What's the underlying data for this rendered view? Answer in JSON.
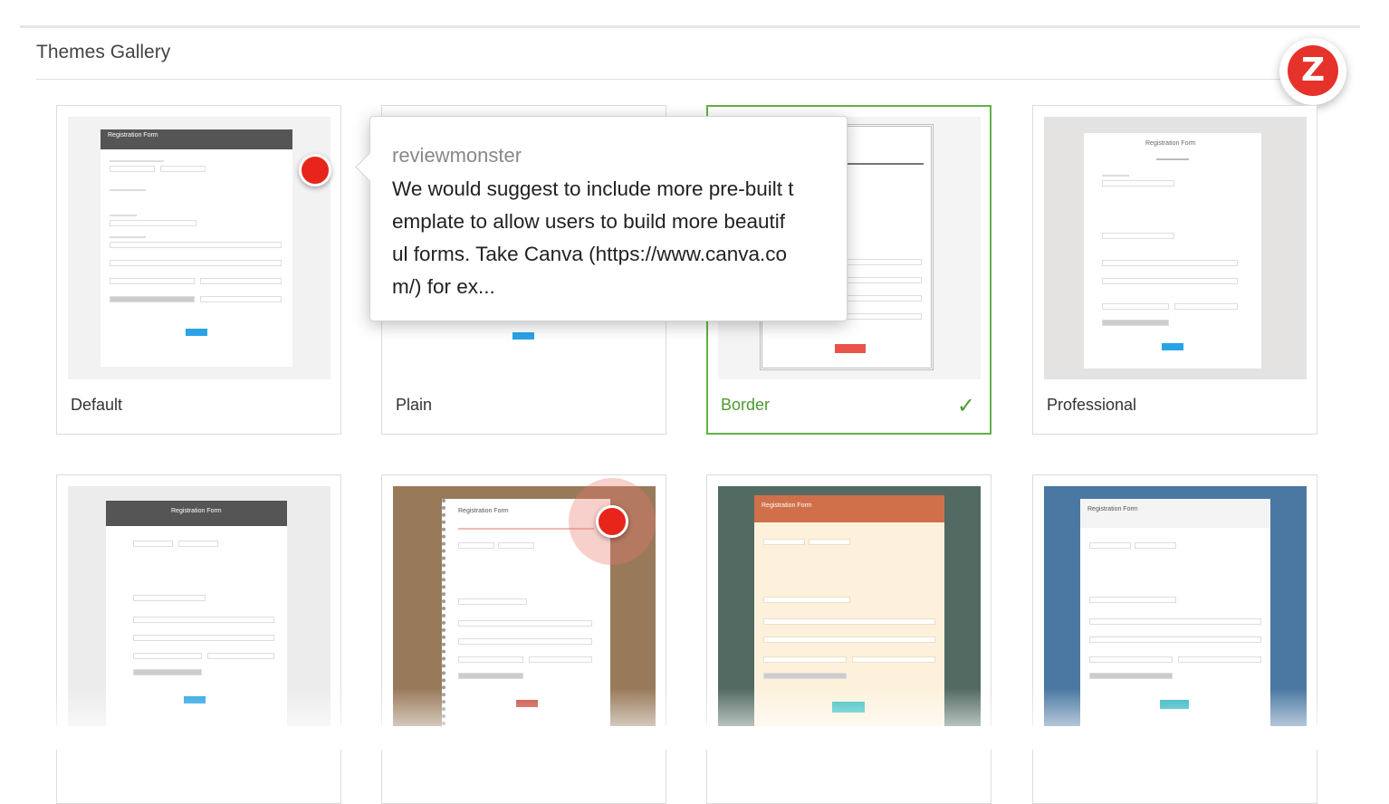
{
  "header": {
    "title": "Themes Gallery"
  },
  "logo": {
    "letter": "Z"
  },
  "themes": [
    {
      "name": "Default",
      "selected": false
    },
    {
      "name": "Plain",
      "selected": false
    },
    {
      "name": "Border",
      "selected": true
    },
    {
      "name": "Professional",
      "selected": false
    },
    {
      "name": "",
      "selected": false
    },
    {
      "name": "",
      "selected": false
    },
    {
      "name": "",
      "selected": false
    },
    {
      "name": "",
      "selected": false
    }
  ],
  "thumbnail_text": {
    "form_title": "Registration Form",
    "form_subtitle": "Register your ticket now",
    "submit": "Submit"
  },
  "tooltip": {
    "user": "reviewmonster",
    "comment": "We would suggest to include more pre-built template to allow users to build more beautiful forms. Take Canva (https://www.canva.com/) for ex..."
  },
  "colors": {
    "accent": "#62b145",
    "hotspot": "#e8251b",
    "brand": "#e5322b",
    "submit_blue": "#2aa3e6"
  }
}
